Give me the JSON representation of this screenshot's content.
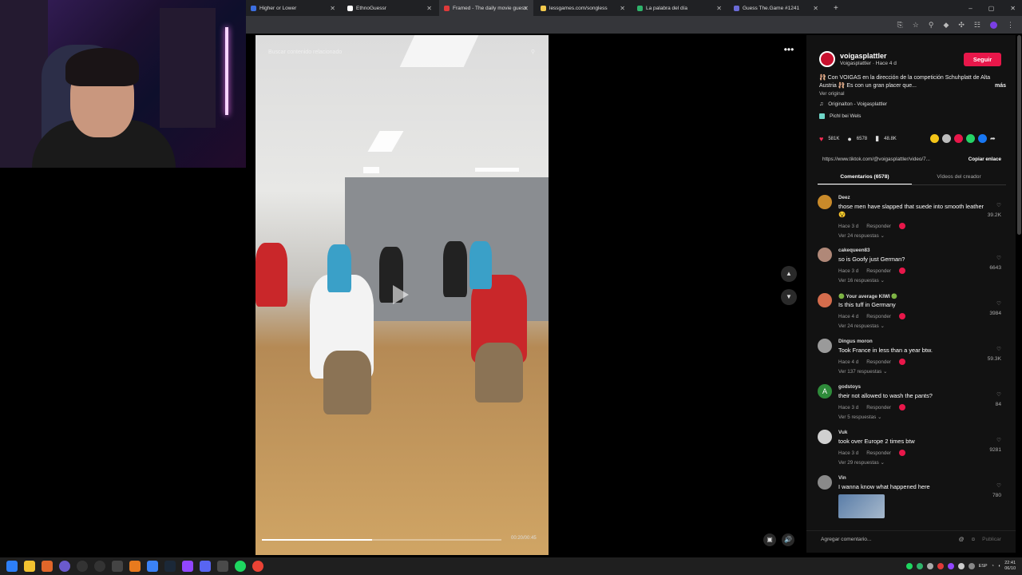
{
  "browser": {
    "tabs": [
      {
        "title": "Higher or Lower",
        "color": "#3c6fe0"
      },
      {
        "title": "EthnoGuessr",
        "color": "#ffffff"
      },
      {
        "title": "Framed - The daily movie guess",
        "color": "#e03a3a"
      },
      {
        "title": "lessgames.com/songless",
        "color": "#f2c94c"
      },
      {
        "title": "La palabra del día",
        "color": "#2fb36b"
      },
      {
        "title": "Guess The.Game #1241",
        "color": "#6b6bd6"
      }
    ],
    "new_tab": "+",
    "window_controls": [
      "–",
      "▢",
      "✕"
    ]
  },
  "video": {
    "search_placeholder": "Buscar contenido relacionado",
    "timecode": "00:20/00:45",
    "progress": 0.46,
    "more_label": "•••",
    "nav_up": "▲",
    "nav_down": "▼",
    "volume_icon": "🔊",
    "captions_icon": "▣"
  },
  "post": {
    "author": "voigasplattler",
    "subline": "Voigasplattler · Hace 4 d",
    "follow_label": "Seguir",
    "description": "🩰 Con VOIGAS en la dirección de la competición Schuhplatt de Alta Austria 🩰 Es con un gran placer que...",
    "more_label": "más",
    "original_label": "Ver original",
    "sound": "Originalton - Voigasplattler",
    "location": "Pichl bei Wels",
    "likes": "581K",
    "comments_count": "6578",
    "saves": "48.8K",
    "link": "https://www.tiktok.com/@voigasplattler/video/7...",
    "copy_label": "Copiar enlace",
    "tab_comments": "Comentarios (6578)",
    "tab_videos": "Vídeos del creador",
    "share_colors": [
      "#f5c518",
      "#bdbdbd",
      "#e8174a",
      "#25d366",
      "#1877f2"
    ]
  },
  "comments": [
    {
      "user": "Deez",
      "text": "those men have slapped that suede into smooth leather 😵",
      "time": "Hace 3 d",
      "reply": "Responder",
      "replies": "Ver 24 respuestas ⌄",
      "likes": "39.2K",
      "avatar": "#c98a2a"
    },
    {
      "user": "cakequeen83",
      "text": "so is Goofy just German?",
      "time": "Hace 3 d",
      "reply": "Responder",
      "replies": "Ver 16 respuestas ⌄",
      "likes": "6643",
      "avatar": "#b08878"
    },
    {
      "user": "🟢 Your average KIWI 🟢",
      "text": "Is this tuff in Germany",
      "time": "Hace 4 d",
      "reply": "Responder",
      "replies": "Ver 24 respuestas ⌄",
      "likes": "3984",
      "avatar": "#d46c4c"
    },
    {
      "user": "Dingus moron",
      "text": "Took France in less than a year btw.",
      "time": "Hace 4 d",
      "reply": "Responder",
      "replies": "Ver 137 respuestas ⌄",
      "likes": "59.3K",
      "avatar": "#9a9a9a"
    },
    {
      "user": "godstoys",
      "text": "their not allowed to wash the pants?",
      "time": "Hace 3 d",
      "reply": "Responder",
      "replies": "Ver 5 respuestas ⌄",
      "likes": "84",
      "avatar": "#2e8b3a",
      "initial": "A"
    },
    {
      "user": "Vuk",
      "text": "took over Europe 2 times btw",
      "time": "Hace 3 d",
      "reply": "Responder",
      "replies": "Ver 29 respuestas ⌄",
      "likes": "9281",
      "avatar": "#d0d0d0"
    },
    {
      "user": "Vin",
      "text": "I wanna know what happened here",
      "likes": "780",
      "avatar": "#8a8a8a"
    }
  ],
  "footer": {
    "placeholder": "Agregar comentario...",
    "at_icon": "@",
    "emoji_icon": "☺",
    "publish_label": "Publicar"
  },
  "taskbar": {
    "lang": "ESP",
    "time": "22:41",
    "date": "06/10"
  }
}
